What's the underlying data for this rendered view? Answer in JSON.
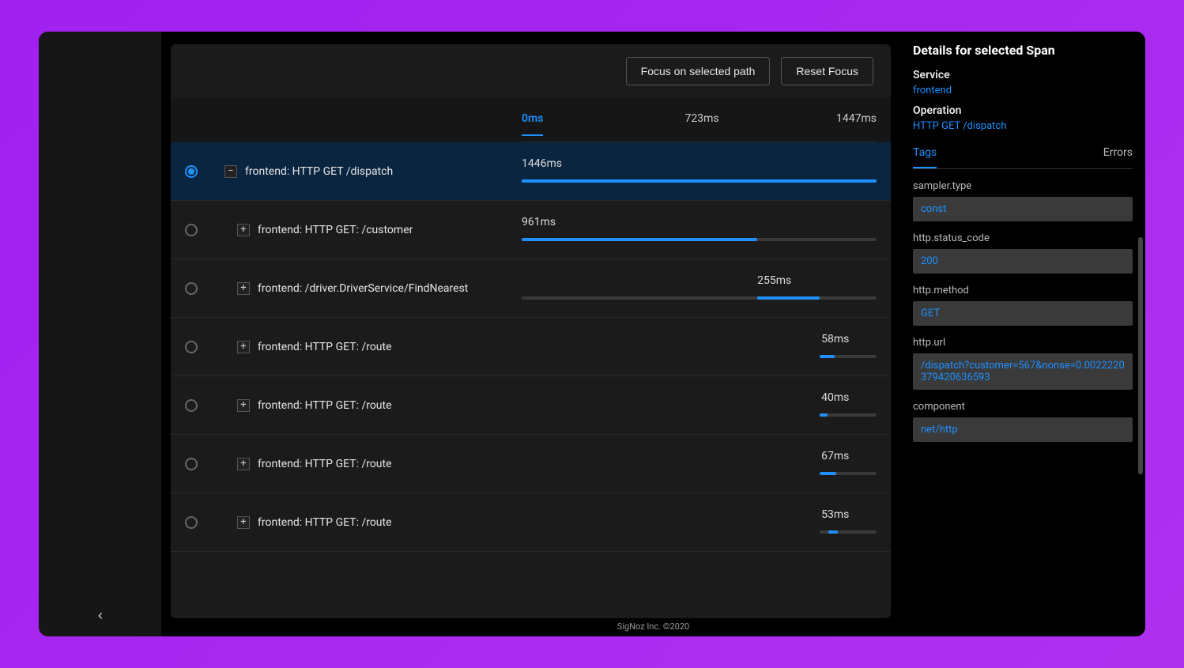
{
  "toolbar": {
    "focus_btn": "Focus on selected path",
    "reset_btn": "Reset Focus"
  },
  "timeline": {
    "ticks": [
      "0ms",
      "723ms",
      "1447ms"
    ],
    "max_ms": 1447
  },
  "spans": [
    {
      "label": "frontend: HTTP GET /dispatch",
      "duration": "1446ms",
      "start_pct": 0,
      "width_pct": 100,
      "selected": true,
      "expanded": true,
      "indent": 0
    },
    {
      "label": "frontend: HTTP GET: /customer",
      "duration": "961ms",
      "start_pct": 0,
      "width_pct": 66.4,
      "selected": false,
      "expanded": false,
      "indent": 1
    },
    {
      "label": "frontend: /driver.DriverService/FindNearest",
      "duration": "255ms",
      "start_pct": 66.4,
      "width_pct": 17.6,
      "selected": false,
      "expanded": false,
      "indent": 1
    },
    {
      "label": "frontend: HTTP GET: /route",
      "duration": "58ms",
      "start_pct": 84.0,
      "width_pct": 4.3,
      "selected": false,
      "expanded": false,
      "indent": 1,
      "short": true
    },
    {
      "label": "frontend: HTTP GET: /route",
      "duration": "40ms",
      "start_pct": 84.0,
      "width_pct": 2.3,
      "selected": false,
      "expanded": false,
      "indent": 1,
      "short": true
    },
    {
      "label": "frontend: HTTP GET: /route",
      "duration": "67ms",
      "start_pct": 84.0,
      "width_pct": 4.6,
      "selected": false,
      "expanded": false,
      "indent": 1,
      "short": true
    },
    {
      "label": "frontend: HTTP GET: /route",
      "duration": "53ms",
      "start_pct": 86.5,
      "width_pct": 2.5,
      "selected": false,
      "expanded": false,
      "indent": 1,
      "short": true
    }
  ],
  "details": {
    "title": "Details for selected Span",
    "service_label": "Service",
    "service_value": "frontend",
    "operation_label": "Operation",
    "operation_value": "HTTP GET /dispatch",
    "tabs": {
      "tags": "Tags",
      "errors": "Errors"
    },
    "tags": [
      {
        "key": "sampler.type",
        "value": "const"
      },
      {
        "key": "http.status_code",
        "value": "200"
      },
      {
        "key": "http.method",
        "value": "GET"
      },
      {
        "key": "http.url",
        "value": "/dispatch?customer=567&nonse=0.0022220379420636593"
      },
      {
        "key": "component",
        "value": "net/http"
      }
    ]
  },
  "footer": "SigNoz Inc. ©2020"
}
